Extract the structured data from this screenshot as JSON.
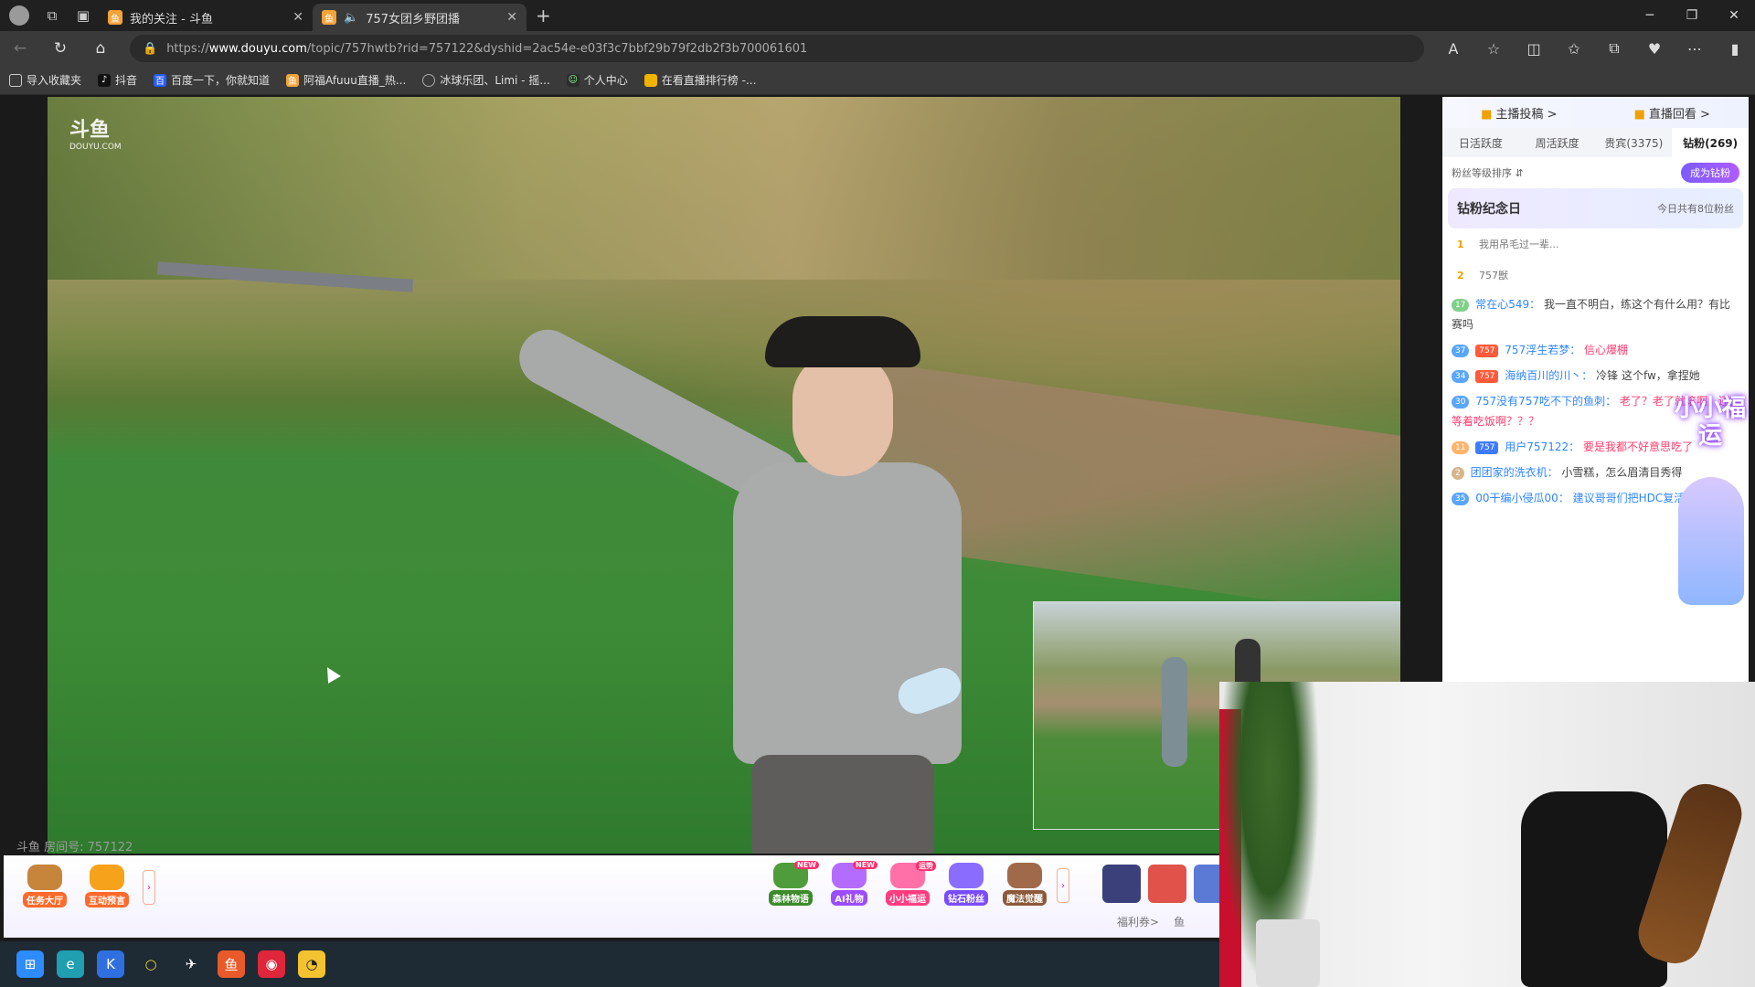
{
  "browser": {
    "tabs": [
      {
        "title": "我的关注 - 斗鱼",
        "active": false
      },
      {
        "title": "757女团乡野团播",
        "active": true
      }
    ],
    "url_prefix": "https://",
    "url_host": "www.douyu.com",
    "url_rest": "/topic/757hwtb?rid=757122&dyshid=2ac54e-e03f3c7bbf29b79f2db2f3b700061601",
    "bookmarks": [
      {
        "label": "导入收藏夹",
        "icon": "import-icon"
      },
      {
        "label": "抖音",
        "icon": "douyin-icon"
      },
      {
        "label": "百度一下，你就知道",
        "icon": "baidu-icon"
      },
      {
        "label": "阿福Afuuu直播_热...",
        "icon": "douyu-icon"
      },
      {
        "label": "冰球乐团、Limi - 摇...",
        "icon": "circle-icon"
      },
      {
        "label": "个人中心",
        "icon": "user-icon"
      },
      {
        "label": "在看直播排行榜 -...",
        "icon": "bookmark-icon"
      }
    ]
  },
  "video": {
    "watermark": "斗鱼",
    "watermark_sub": "DOUYU.COM",
    "room_id": "斗鱼 房间号: 757122"
  },
  "giftbar": {
    "left_buttons": [
      {
        "label": "任务大厅"
      },
      {
        "label": "互动预言"
      }
    ],
    "activity_buttons": [
      {
        "label": "森林物语",
        "badge": "NEW"
      },
      {
        "label": "AI礼物",
        "badge": "NEW"
      },
      {
        "label": "小小福运",
        "badge": "运势"
      },
      {
        "label": "钻石粉丝",
        "badge": ""
      },
      {
        "label": "魔法觉醒",
        "badge": ""
      }
    ],
    "bottom_links": [
      "福利券>",
      "鱼"
    ]
  },
  "panel": {
    "top_links": [
      "主播投稿 >",
      "直播回看 >"
    ],
    "rank_tabs": [
      "日活跃度",
      "周活跃度",
      "贵宾(3375)",
      "钻粉(269)"
    ],
    "active_rank_tab": 3,
    "sort_label": "粉丝等级排序 ⇵",
    "be_diamond": "成为钻粉",
    "anniversary_title": "钻粉纪念日",
    "anniversary_count": "今日共有8位粉丝",
    "fans": [
      {
        "idx": "1",
        "name": "我用吊毛过一辈..."
      },
      {
        "idx": "2",
        "name": "757獣"
      }
    ],
    "promo_text": "小小福运",
    "messages": [
      {
        "level": "17",
        "name": "常在心549：",
        "text": "我一直不明白，练这个有什么用？有比赛吗",
        "highlight": false
      },
      {
        "level": "37",
        "fan": "757",
        "name": "757浮生若梦：",
        "text": "信心爆棚",
        "highlight": true
      },
      {
        "level": "34",
        "fan": "757",
        "name": "海纳百川的川丶：",
        "text": "冷锋 这个fw，拿捏她",
        "highlight": false
      },
      {
        "level": "30",
        "name": "757没有757吃不下的鱼刺：",
        "text": "老了？老了就滚啊，还等着吃饭啊？？？",
        "highlight": true
      },
      {
        "level": "11",
        "fan": "757",
        "name": "用户757122：",
        "text": "要是我都不好意思吃了",
        "highlight": true
      },
      {
        "level": "2",
        "name": "团团家的洗衣机：",
        "text": "小雪糕，怎么眉清目秀得",
        "highlight": false
      },
      {
        "level": "35",
        "name": "00干编小侵瓜00：",
        "text": "建议哥哥们把HDC复活了",
        "highlight": false
      }
    ]
  },
  "colors": {
    "accent": "#ff6a2b",
    "diamond": "#8a5cff",
    "username": "#2f86ff",
    "highlight": "#ff3d6e"
  }
}
